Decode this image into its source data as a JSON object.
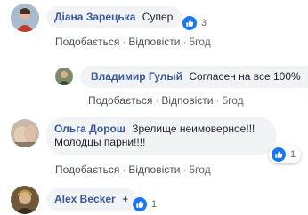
{
  "comments": [
    {
      "author": "Діана Зарецька",
      "text": "Супер",
      "actions": {
        "like": "Подобається",
        "reply": "Відповісти",
        "time": "5год"
      },
      "reactions": {
        "count": "3",
        "icon": "like-icon"
      }
    },
    {
      "author": "Владимир Гулый",
      "text": "Согласен на все 100%",
      "actions": {
        "like": "Подобається",
        "reply": "Відповісти",
        "time": "5год"
      }
    },
    {
      "author": "Ольга Дорош",
      "text_line1": "Зрелище неимоверное!!!",
      "text_line2": "Молодцы парни!!!!",
      "actions": {
        "like": "Подобається",
        "reply": "Відповісти",
        "time": "5год"
      },
      "reactions": {
        "count": "1",
        "icon": "like-icon"
      }
    },
    {
      "author": "Alex Becker",
      "text": "+",
      "reactions": {
        "count": "1",
        "icon": "like-icon"
      }
    }
  ],
  "colors": {
    "author": "#385898",
    "bubble": "#f2f3f5",
    "like_blue": "#1877f2",
    "meta": "#606770"
  },
  "separator": "·"
}
